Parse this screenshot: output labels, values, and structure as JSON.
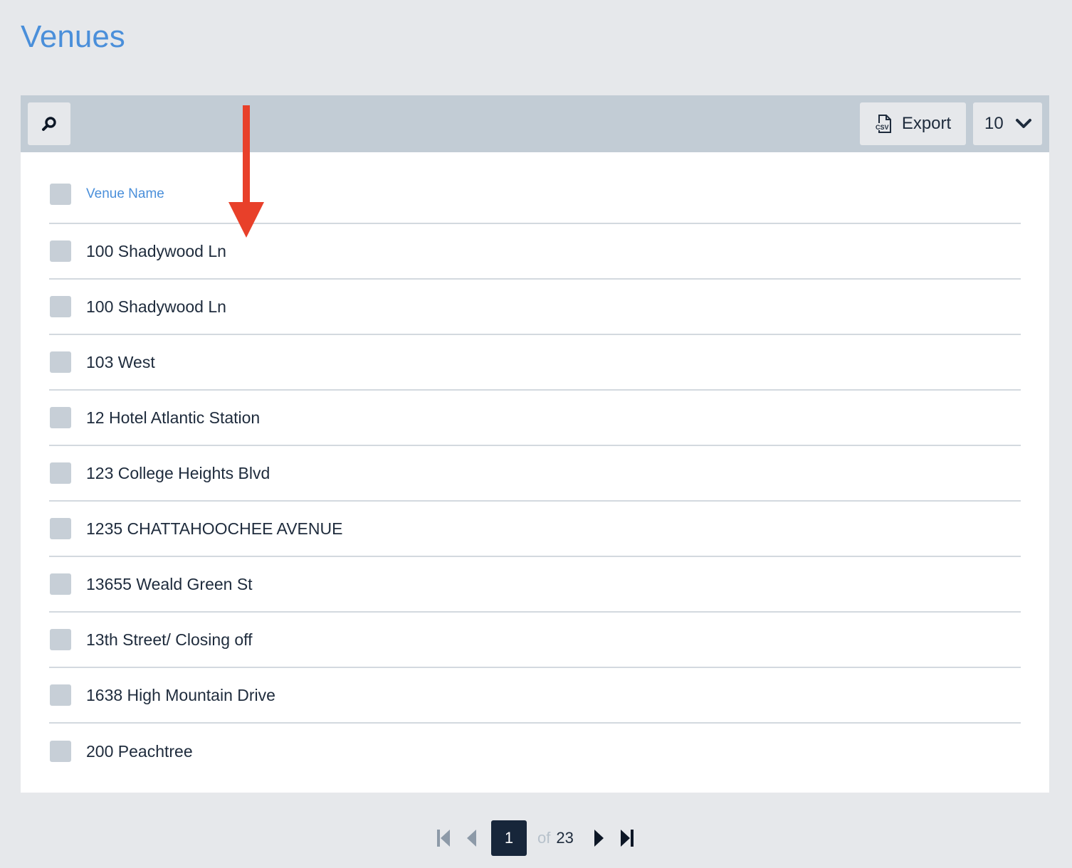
{
  "page": {
    "title": "Venues"
  },
  "toolbar": {
    "search_icon": "search-icon",
    "export_label": "Export",
    "export_icon": "csv-file-icon",
    "export_icon_text": "CSV",
    "per_page_value": "10",
    "per_page_icon": "chevron-down-icon"
  },
  "table": {
    "column_header": "Venue Name",
    "rows": [
      "100 Shadywood Ln",
      "100 Shadywood Ln",
      "103 West",
      "12 Hotel Atlantic Station",
      "123 College Heights Blvd",
      "1235 CHATTAHOOCHEE AVENUE",
      "13655 Weald Green St",
      "13th Street/ Closing off",
      "1638 High Mountain Drive",
      "200 Peachtree"
    ]
  },
  "annotation": {
    "arrow_color": "#e8402a",
    "icon": "arrow-down-icon"
  },
  "pagination": {
    "current_page": "1",
    "of_label": "of",
    "total_pages": "23"
  },
  "colors": {
    "accent": "#4a8fda",
    "toolbar": "#c2ccd5",
    "page_box": "#17263a"
  }
}
